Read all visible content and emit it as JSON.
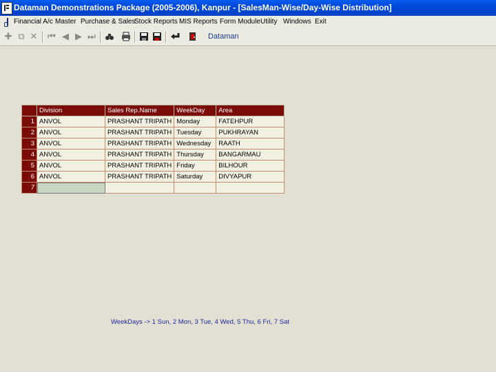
{
  "window": {
    "title": "Dataman Demonstrations Package (2005-2006), Kanpur - [SalesMan-Wise/Day-Wise Distribution]"
  },
  "menu": {
    "items": [
      "Financial A/c",
      "Master",
      "Purchase & Sales",
      "Stock Reports",
      "MIS Reports",
      "Form Module",
      "Utility",
      "Windows",
      "Exit"
    ]
  },
  "toolbar": {
    "label": "Dataman",
    "icons": [
      "add-icon",
      "copy-icon",
      "delete-icon",
      "first-record-icon",
      "previous-record-icon",
      "next-record-icon",
      "last-record-icon",
      "find-icon",
      "print-icon",
      "save-icon",
      "save-all-icon",
      "undo-icon",
      "exit-icon"
    ]
  },
  "grid": {
    "columns": [
      "Division",
      "Sales Rep.Name",
      "WeekDay",
      "Area"
    ],
    "rows": [
      {
        "num": "1",
        "division": "ANVOL",
        "rep": "PRASHANT TRIPATH",
        "day": "Monday",
        "area": "FATEHPUR"
      },
      {
        "num": "2",
        "division": "ANVOL",
        "rep": "PRASHANT TRIPATH",
        "day": "Tuesday",
        "area": "PUKHRAYAN"
      },
      {
        "num": "3",
        "division": "ANVOL",
        "rep": "PRASHANT TRIPATH",
        "day": "Wednesday",
        "area": "RAATH"
      },
      {
        "num": "4",
        "division": "ANVOL",
        "rep": "PRASHANT TRIPATH",
        "day": "Thursday",
        "area": "BANGARMAU"
      },
      {
        "num": "5",
        "division": "ANVOL",
        "rep": "PRASHANT TRIPATH",
        "day": "Friday",
        "area": "BILHOUR"
      },
      {
        "num": "6",
        "division": "ANVOL",
        "rep": "PRASHANT TRIPATH",
        "day": "Saturday",
        "area": "DIVYAPUR"
      }
    ],
    "new_row_num": "7"
  },
  "footnote": "WeekDays -> 1 Sun, 2 Mon, 3 Tue, 4 Wed, 5 Thu, 6 Fri, 7 Sat",
  "colors": {
    "title_bar": "#0047d8",
    "grid_header": "#7a0b07",
    "grid_cell": "#f2f1e1",
    "background": "#e2e0d3",
    "footnote_text": "#1e2aa0"
  }
}
